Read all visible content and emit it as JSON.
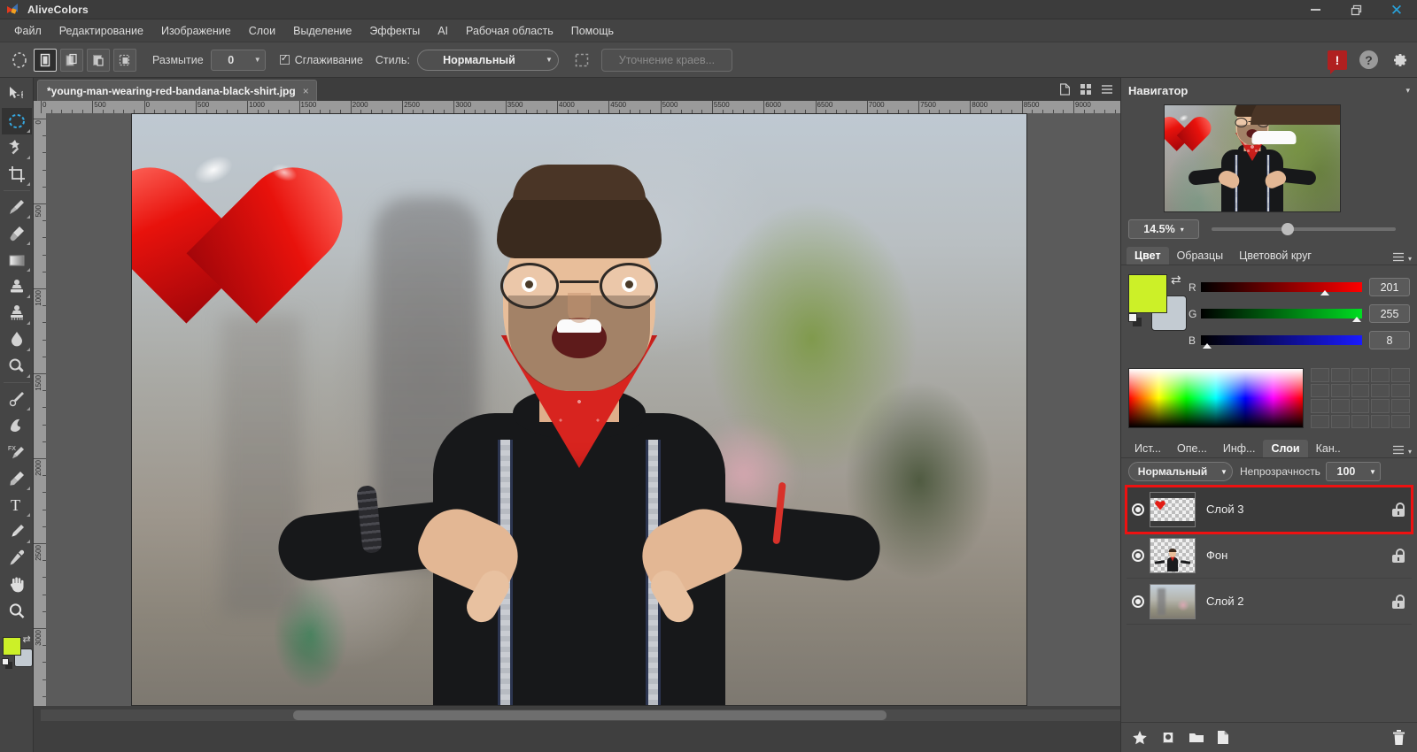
{
  "app": {
    "name": "AliveColors",
    "logo_icon": "alivecolors-logo"
  },
  "window_controls": [
    {
      "name": "minimize",
      "glyph": "—"
    },
    {
      "name": "restore",
      "glyph": "❐"
    },
    {
      "name": "close",
      "glyph": "✕"
    }
  ],
  "menubar": {
    "items": [
      {
        "label": "Файл"
      },
      {
        "label": "Редактирование"
      },
      {
        "label": "Изображение"
      },
      {
        "label": "Слои"
      },
      {
        "label": "Выделение"
      },
      {
        "label": "Эффекты"
      },
      {
        "label": "AI"
      },
      {
        "label": "Рабочая область"
      },
      {
        "label": "Помощь"
      }
    ]
  },
  "options_bar": {
    "selection_modes": [
      {
        "name": "new-selection",
        "active": true
      },
      {
        "name": "add-to-selection",
        "active": false
      },
      {
        "name": "subtract-from-selection",
        "active": false
      },
      {
        "name": "intersect-selection",
        "active": false
      }
    ],
    "feather_label": "Размытие",
    "feather_value": "0",
    "antialias_label": "Сглаживание",
    "antialias_checked": true,
    "style_label": "Стиль:",
    "style_value": "Нормальный",
    "refine_edges_label": "Уточнение краев...",
    "right_icons": [
      {
        "name": "alert-icon",
        "glyph": "!"
      },
      {
        "name": "help-icon",
        "glyph": "?"
      },
      {
        "name": "settings-gear-icon",
        "glyph": "⚙"
      }
    ]
  },
  "toolbar": {
    "tools": [
      {
        "name": "move-tool",
        "icon": "move-icon",
        "active": false,
        "has_flyout": false
      },
      {
        "name": "elliptical-selection-tool",
        "icon": "ellipse-selection-icon",
        "active": true,
        "has_flyout": true
      },
      {
        "name": "magic-wand-tool",
        "icon": "magic-wand-icon",
        "active": false,
        "has_flyout": true
      },
      {
        "name": "crop-tool",
        "icon": "crop-icon",
        "active": false,
        "has_flyout": true
      },
      {
        "name": "brush-tool",
        "icon": "brush-icon",
        "active": false,
        "has_flyout": true
      },
      {
        "name": "eraser-tool",
        "icon": "eraser-icon",
        "active": false,
        "has_flyout": true
      },
      {
        "name": "gradient-tool",
        "icon": "gradient-icon",
        "active": false,
        "has_flyout": true
      },
      {
        "name": "clone-stamp-tool",
        "icon": "stamp-icon",
        "active": false,
        "has_flyout": true
      },
      {
        "name": "pattern-stamp-tool",
        "icon": "pattern-stamp-icon",
        "active": false,
        "has_flyout": true
      },
      {
        "name": "blur-tool",
        "icon": "water-drop-icon",
        "active": false,
        "has_flyout": true
      },
      {
        "name": "dodge-tool",
        "icon": "dodge-icon",
        "active": false,
        "has_flyout": true
      },
      {
        "name": "sharpen-tool",
        "icon": "sharpen-icon",
        "active": false,
        "has_flyout": true
      },
      {
        "name": "smudge-tool",
        "icon": "smudge-icon",
        "active": false,
        "has_flyout": false
      },
      {
        "name": "fx-brush-tool",
        "icon": "fx-brush-icon",
        "active": false,
        "has_flyout": false
      },
      {
        "name": "marker-tool",
        "icon": "marker-icon",
        "active": false,
        "has_flyout": true
      },
      {
        "name": "text-tool",
        "icon": "text-t-icon",
        "active": false,
        "has_flyout": true
      },
      {
        "name": "pen-tool",
        "icon": "pen-icon",
        "active": false,
        "has_flyout": true
      },
      {
        "name": "eyedropper-tool",
        "icon": "eyedropper-icon",
        "active": false,
        "has_flyout": false
      },
      {
        "name": "hand-tool",
        "icon": "hand-icon",
        "active": false,
        "has_flyout": false
      },
      {
        "name": "zoom-tool",
        "icon": "magnifier-icon",
        "active": false,
        "has_flyout": false
      }
    ],
    "foreground_color": "#CCF028",
    "background_color": "#C3CBD2"
  },
  "document": {
    "tab_title": "*young-man-wearing-red-bandana-black-shirt.jpg",
    "close_glyph": "×",
    "view_icons": [
      {
        "name": "single-document-view-icon"
      },
      {
        "name": "tile-view-icon"
      },
      {
        "name": "document-menu-icon"
      }
    ],
    "ruler_h_ticks": [
      "0",
      "500",
      "0",
      "500",
      "1000",
      "1500",
      "2000",
      "2500",
      "3000",
      "3500",
      "4000",
      "4500",
      "5000",
      "5500",
      "6000",
      "6500",
      "7000",
      "7500",
      "8000",
      "8500",
      "9000"
    ],
    "ruler_v_ticks": [
      "0",
      "500",
      "1000",
      "1500",
      "2000",
      "2500",
      "3000"
    ]
  },
  "navigator": {
    "title": "Навигатор",
    "zoom_value": "14.5%",
    "zoom_caret": "▾",
    "collapse_caret": "▾"
  },
  "color_panel": {
    "tabs": [
      {
        "label": "Цвет",
        "active": true
      },
      {
        "label": "Образцы",
        "active": false
      },
      {
        "label": "Цветовой круг",
        "active": false
      }
    ],
    "menu_icon": "hamburger-icon",
    "caret": "▾",
    "channels": [
      {
        "label": "R",
        "value": "201",
        "pct": 78.8
      },
      {
        "label": "G",
        "value": "255",
        "pct": 100
      },
      {
        "label": "B",
        "value": "8",
        "pct": 3.1
      }
    ],
    "foreground_color": "#CCF028",
    "background_color": "#C3CBD2",
    "swatch_count": 20
  },
  "layers_panel": {
    "tabs": [
      {
        "label": "Ист...",
        "active": false
      },
      {
        "label": "Опе...",
        "active": false
      },
      {
        "label": "Инф...",
        "active": false
      },
      {
        "label": "Слои",
        "active": true
      },
      {
        "label": "Кан..",
        "active": false
      }
    ],
    "menu_icon": "hamburger-icon",
    "caret": "▾",
    "blend_mode": "Нормальный",
    "opacity_label": "Непрозрачность",
    "opacity_value": "100",
    "selection_outline_color": "#EE1111",
    "layers": [
      {
        "name": "Слой 3",
        "visible": true,
        "selected": true,
        "locked": false,
        "thumb": "heart-transparent"
      },
      {
        "name": "Фон",
        "visible": true,
        "selected": false,
        "locked": false,
        "thumb": "person-cutout"
      },
      {
        "name": "Слой 2",
        "visible": true,
        "selected": false,
        "locked": false,
        "thumb": "city-background"
      }
    ],
    "footer_icons": [
      {
        "name": "layer-effects-icon",
        "glyph": "★"
      },
      {
        "name": "layer-mask-icon",
        "glyph": "◑"
      },
      {
        "name": "new-group-icon",
        "glyph": "▰"
      },
      {
        "name": "new-layer-icon",
        "glyph": "▯"
      },
      {
        "name": "delete-layer-icon",
        "glyph": "🗑"
      }
    ]
  }
}
